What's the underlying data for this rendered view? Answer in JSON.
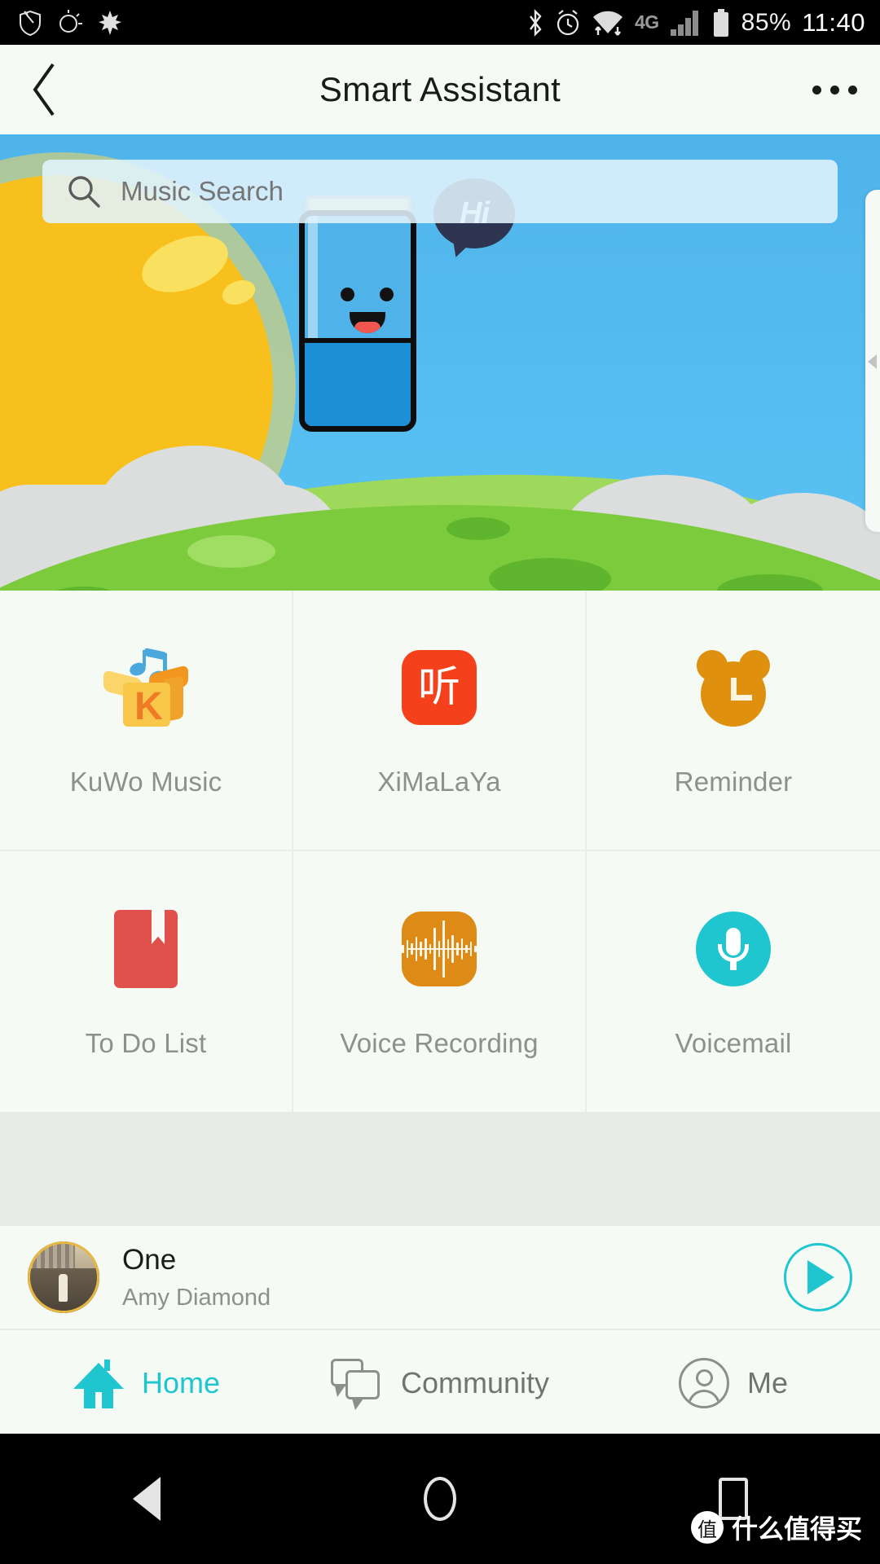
{
  "status_bar": {
    "left_icons": [
      "shield-notification-icon",
      "weather-icon",
      "maple-leaf-icon"
    ],
    "right_icons": [
      "bluetooth-icon",
      "alarm-icon",
      "wifi-icon",
      "signal-icon",
      "battery-icon"
    ],
    "network": "4G",
    "battery": "85%",
    "time": "11:40"
  },
  "header": {
    "back_icon": "chevron-left-icon",
    "title": "Smart Assistant",
    "more_icon": "more-options-icon"
  },
  "banner": {
    "search": {
      "icon": "search-icon",
      "placeholder": "Music Search",
      "value": ""
    },
    "mascot": {
      "name": "smart-speaker-mascot",
      "speech": "Hi"
    },
    "scene": "sunrise-hills-clouds"
  },
  "apps": [
    {
      "label": "KuWo Music",
      "icon": "kuwo-music-icon",
      "color": "#f8c74a"
    },
    {
      "label": "XiMaLaYa",
      "icon": "ximalaya-icon",
      "color": "#f4411c"
    },
    {
      "label": "Reminder",
      "icon": "alarm-clock-icon",
      "color": "#e0900f"
    },
    {
      "label": "To Do List",
      "icon": "notebook-icon",
      "color": "#e0504c"
    },
    {
      "label": "Voice Recording",
      "icon": "waveform-icon",
      "color": "#dd8b16"
    },
    {
      "label": "Voicemail",
      "icon": "microphone-icon",
      "color": "#1fc6cf"
    }
  ],
  "player": {
    "album_art": "album-cover-thumbnail",
    "title": "One",
    "artist": "Amy Diamond",
    "play_icon": "play-icon",
    "accent": "#1fc6cf"
  },
  "tabs": [
    {
      "label": "Home",
      "icon": "home-icon",
      "active": true
    },
    {
      "label": "Community",
      "icon": "chat-bubbles-icon",
      "active": false
    },
    {
      "label": "Me",
      "icon": "user-circle-icon",
      "active": false
    }
  ],
  "nav_bar": {
    "back_icon": "android-back-icon",
    "home_icon": "android-home-icon",
    "recents_icon": "android-recents-icon"
  },
  "watermark": {
    "logo": "值",
    "text": "什么值得买"
  },
  "colors": {
    "accent": "#1fc6cf",
    "page_bg": "#f5faf4",
    "gap_bg": "#e8ebe7",
    "label_gray": "#8b918b",
    "sky": "#4fb3ea"
  }
}
